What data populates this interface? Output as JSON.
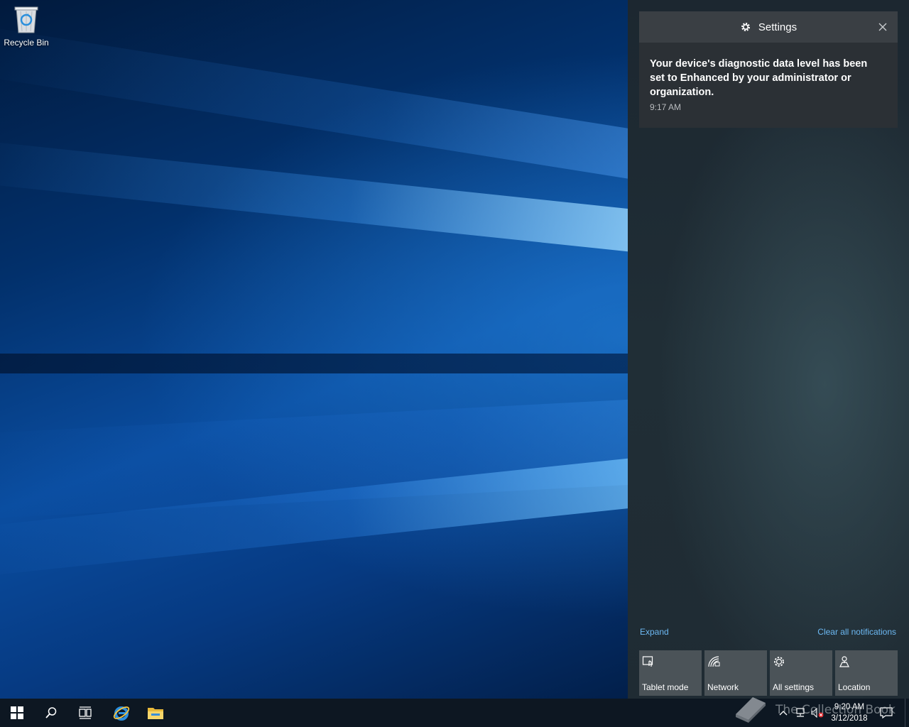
{
  "desktop": {
    "icons": [
      {
        "label": "Recycle Bin",
        "icon": "recycle-bin-icon"
      }
    ]
  },
  "action_center": {
    "notification": {
      "app_title": "Settings",
      "app_icon": "gear-icon",
      "message": "Your device's diagnostic data level has been set to Enhanced by your administrator or organization.",
      "time": "9:17 AM"
    },
    "expand_label": "Expand",
    "clear_label": "Clear all notifications",
    "quick_actions": [
      {
        "label": "Tablet mode",
        "icon": "tablet-mode-icon"
      },
      {
        "label": "Network",
        "icon": "network-icon"
      },
      {
        "label": "All settings",
        "icon": "gear-icon"
      },
      {
        "label": "Location",
        "icon": "location-icon"
      }
    ]
  },
  "taskbar": {
    "pinned": [
      {
        "name": "start",
        "icon": "windows-icon"
      },
      {
        "name": "search",
        "icon": "search-icon"
      },
      {
        "name": "task-view",
        "icon": "task-view-icon"
      },
      {
        "name": "internet-explorer",
        "icon": "internet-explorer-icon"
      },
      {
        "name": "file-explorer",
        "icon": "folder-icon"
      }
    ],
    "clock": {
      "time": "9:20 AM",
      "date": "3/12/2018"
    }
  },
  "watermark": "The Collection Book",
  "colors": {
    "accent_link": "#6cb8f2",
    "tile_bg": "#4b5358",
    "taskbar_bg": "#0d1722"
  }
}
